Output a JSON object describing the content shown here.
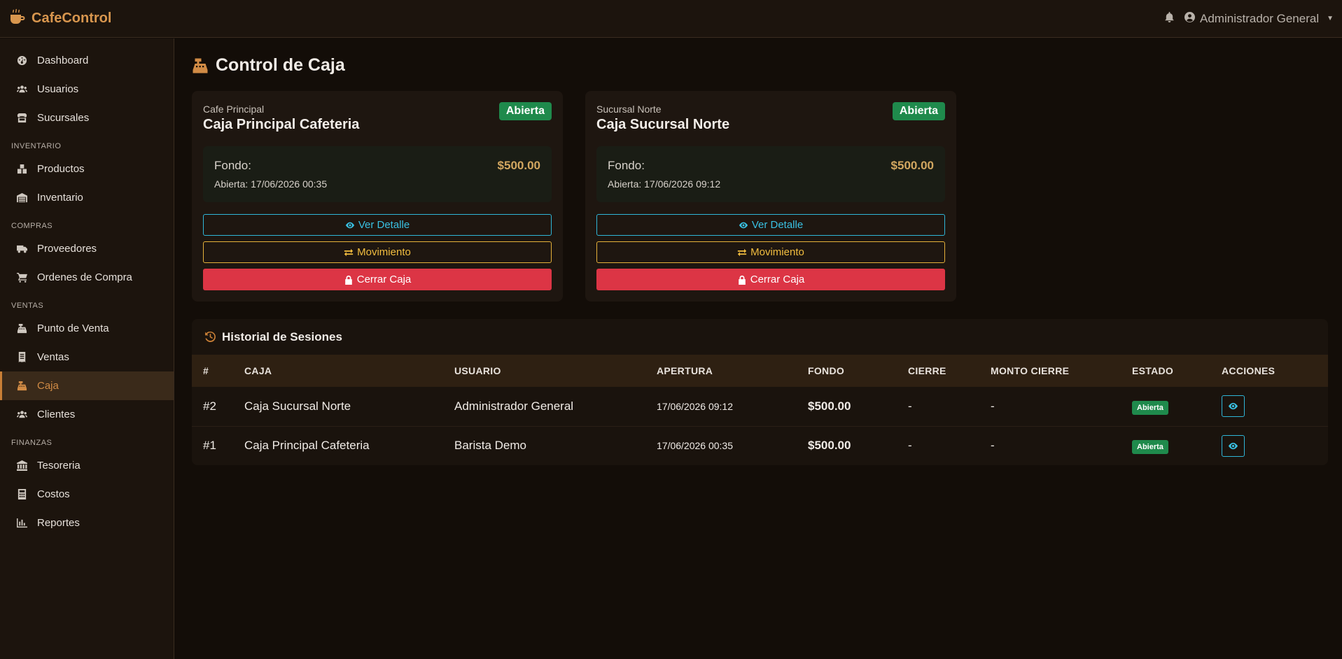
{
  "app": {
    "brand": "CafeControl"
  },
  "header": {
    "user_name": "Administrador General"
  },
  "sidebar": {
    "items_top": [
      {
        "label": "Dashboard",
        "icon": "gauge-icon"
      },
      {
        "label": "Usuarios",
        "icon": "users-icon"
      },
      {
        "label": "Sucursales",
        "icon": "store-icon"
      }
    ],
    "section_inventario": "INVENTARIO",
    "items_inventario": [
      {
        "label": "Productos",
        "icon": "boxes-icon"
      },
      {
        "label": "Inventario",
        "icon": "warehouse-icon"
      }
    ],
    "section_compras": "COMPRAS",
    "items_compras": [
      {
        "label": "Proveedores",
        "icon": "truck-icon"
      },
      {
        "label": "Ordenes de Compra",
        "icon": "cart-icon"
      }
    ],
    "section_ventas": "VENTAS",
    "items_ventas": [
      {
        "label": "Punto de Venta",
        "icon": "cash-register-icon"
      },
      {
        "label": "Ventas",
        "icon": "receipt-icon"
      },
      {
        "label": "Caja",
        "icon": "cash-register-icon",
        "active": true
      },
      {
        "label": "Clientes",
        "icon": "users-icon"
      }
    ],
    "section_finanzas": "FINANZAS",
    "items_finanzas": [
      {
        "label": "Tesoreria",
        "icon": "bank-icon"
      },
      {
        "label": "Costos",
        "icon": "calculator-icon"
      },
      {
        "label": "Reportes",
        "icon": "chart-icon"
      }
    ]
  },
  "page": {
    "title": "Control de Caja"
  },
  "cards": [
    {
      "branch": "Cafe Principal",
      "name": "Caja Principal Cafeteria",
      "status": "Abierta",
      "fund_label": "Fondo:",
      "fund_value": "$500.00",
      "opened": "Abierta: 17/06/2026 00:35",
      "btn_detail": "Ver Detalle",
      "btn_move": "Movimiento",
      "btn_close": "Cerrar Caja"
    },
    {
      "branch": "Sucursal Norte",
      "name": "Caja Sucursal Norte",
      "status": "Abierta",
      "fund_label": "Fondo:",
      "fund_value": "$500.00",
      "opened": "Abierta: 17/06/2026 09:12",
      "btn_detail": "Ver Detalle",
      "btn_move": "Movimiento",
      "btn_close": "Cerrar Caja"
    }
  ],
  "history": {
    "title": "Historial de Sesiones",
    "columns": [
      "#",
      "CAJA",
      "USUARIO",
      "APERTURA",
      "FONDO",
      "CIERRE",
      "MONTO CIERRE",
      "ESTADO",
      "ACCIONES"
    ],
    "rows": [
      {
        "id": "#2",
        "caja": "Caja Sucursal Norte",
        "usuario": "Administrador General",
        "apertura": "17/06/2026 09:12",
        "fondo": "$500.00",
        "cierre": "-",
        "monto": "-",
        "estado": "Abierta"
      },
      {
        "id": "#1",
        "caja": "Caja Principal Cafeteria",
        "usuario": "Barista Demo",
        "apertura": "17/06/2026 00:35",
        "fondo": "$500.00",
        "cierre": "-",
        "monto": "-",
        "estado": "Abierta"
      }
    ]
  },
  "colors": {
    "accent": "#d18b45",
    "success": "#1f8a4c",
    "danger": "#dc3545",
    "info": "#39c1e3",
    "warning": "#f2bd3f"
  }
}
